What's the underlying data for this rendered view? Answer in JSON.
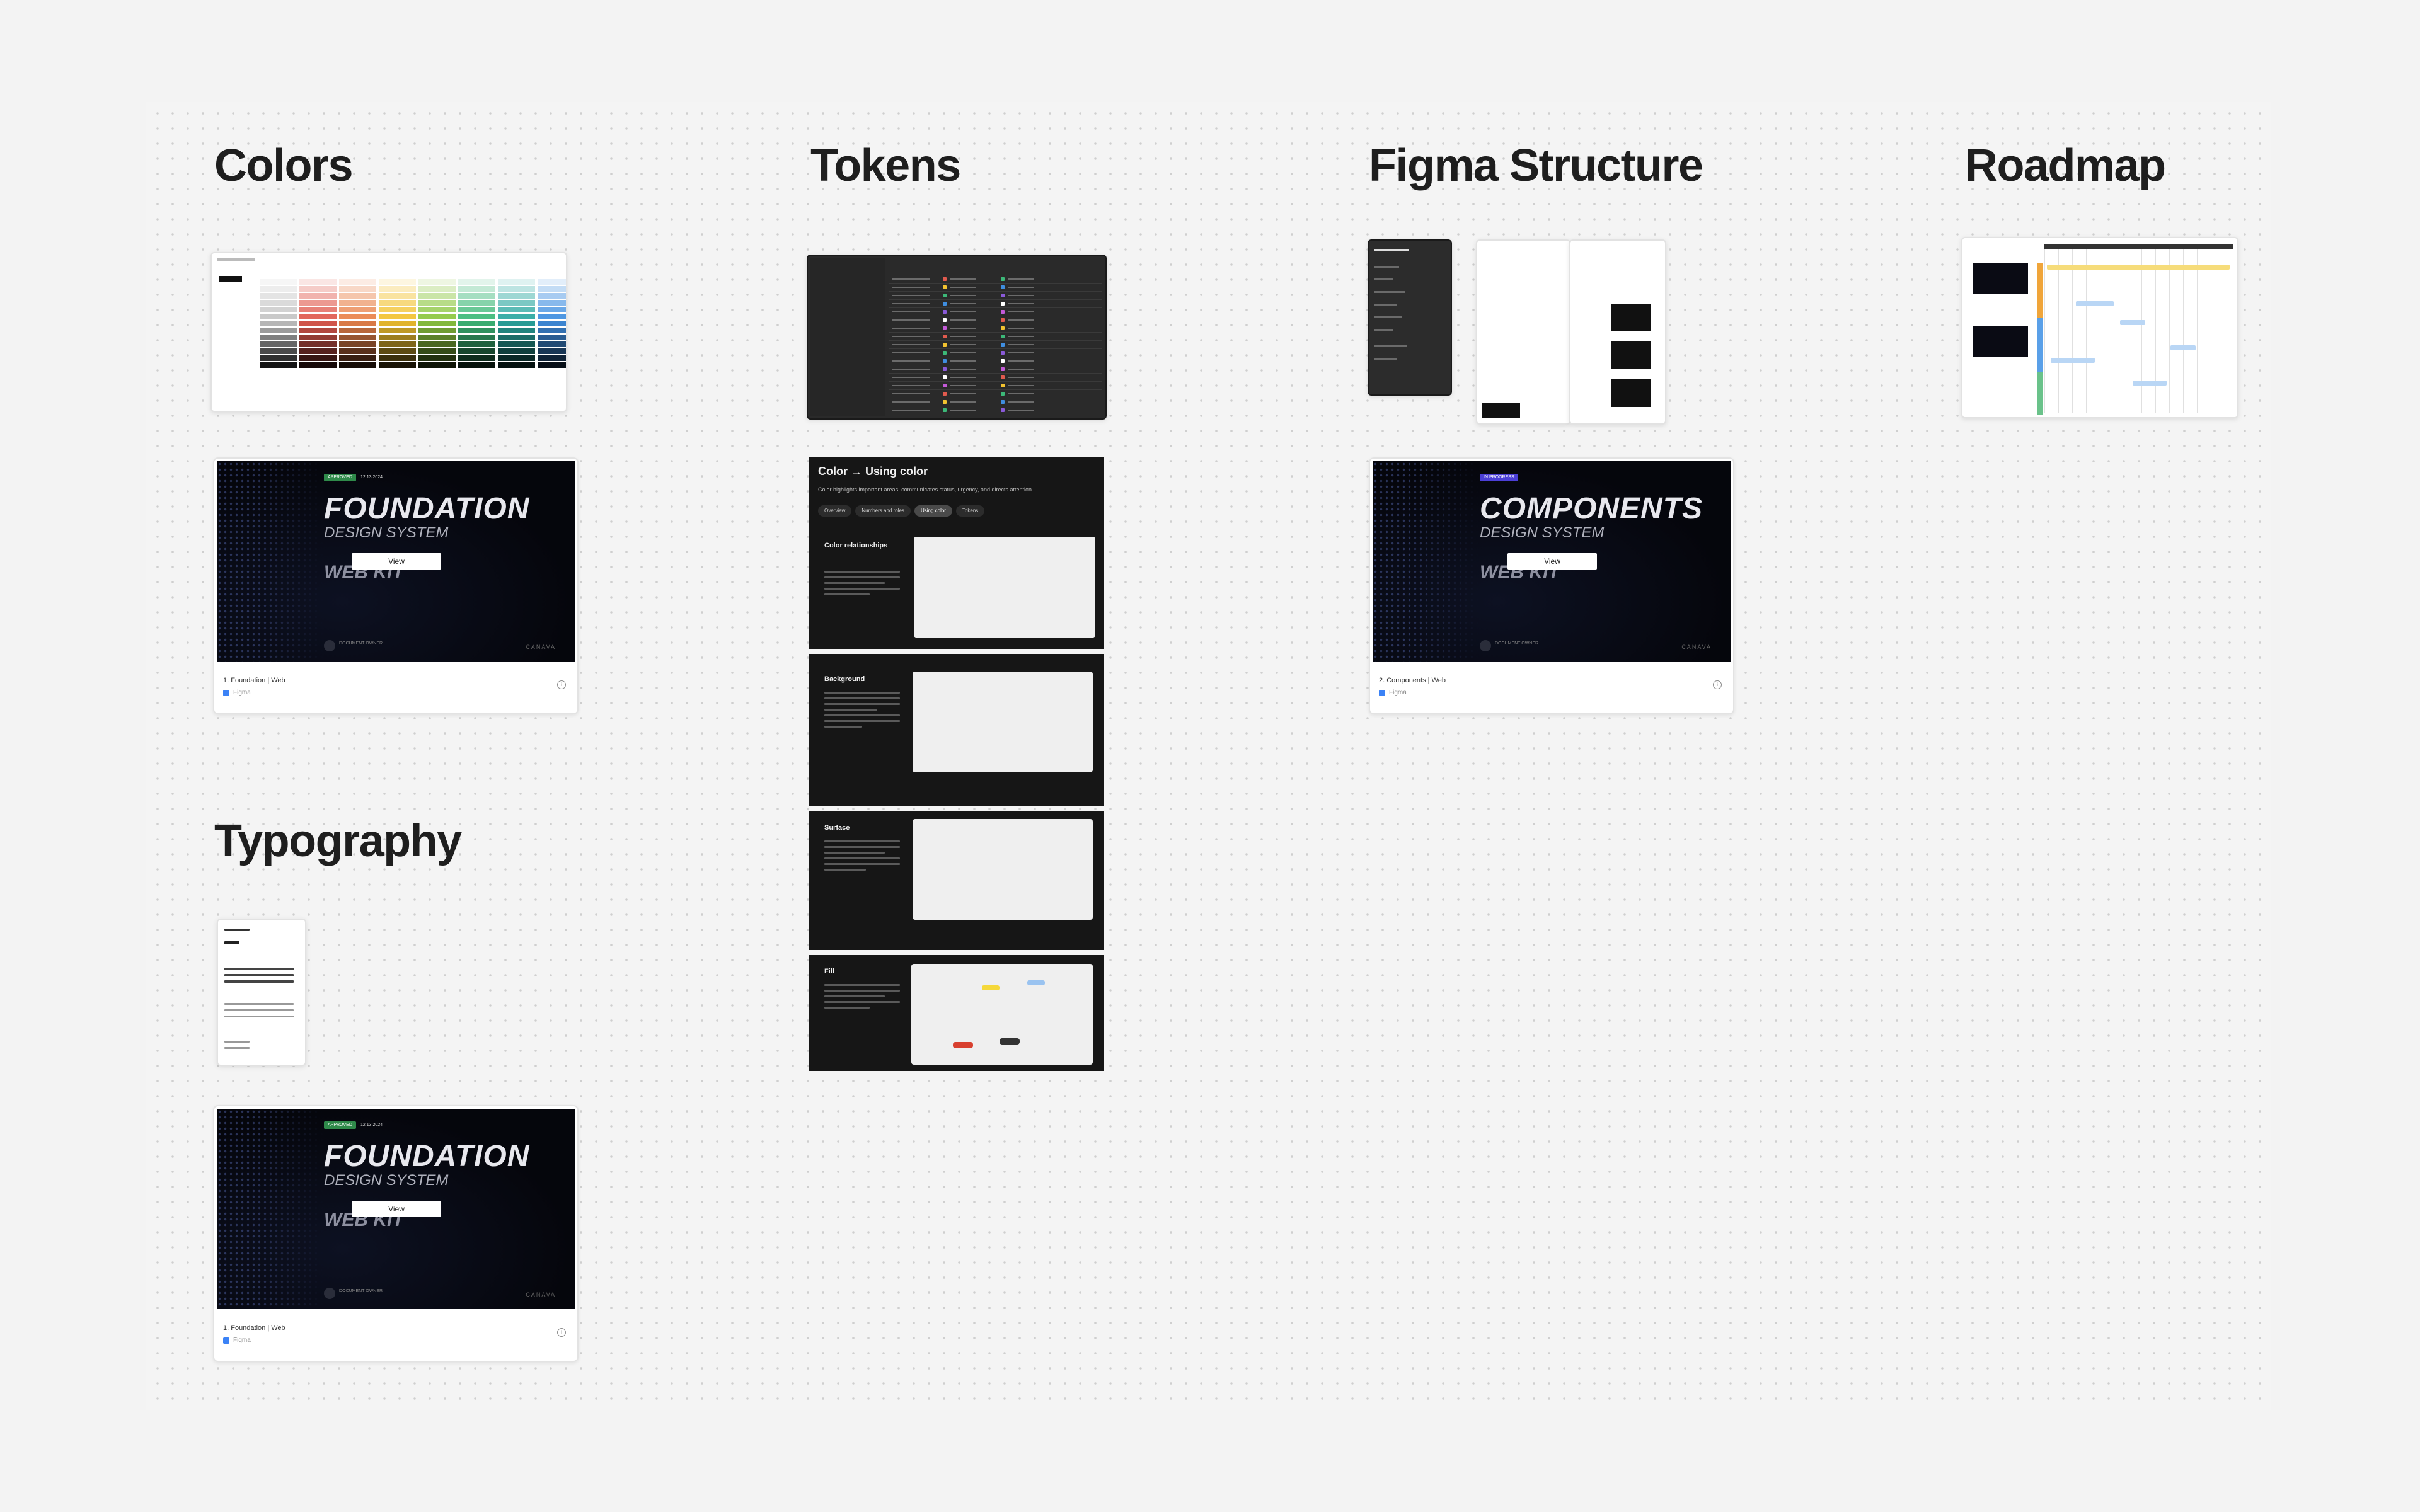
{
  "sections": {
    "colors": "Colors",
    "tokens": "Tokens",
    "figma_structure": "Figma Structure",
    "roadmap": "Roadmap",
    "typography": "Typography"
  },
  "cards": [
    {
      "badge": "APPROVED",
      "badge_color": "#2f8a4a",
      "date": "12.13.2024",
      "title": "FOUNDATION",
      "subtitle": "DESIGN SYSTEM",
      "kit": "WEB KIT",
      "button": "View",
      "author": "DOCUMENT OWNER",
      "brand": "CANAVA",
      "name": "1. Foundation | Web",
      "app": "Figma"
    },
    {
      "badge": "IN PROGRESS",
      "badge_color": "#4b3fd6",
      "date": "",
      "title": "COMPONENTS",
      "subtitle": "DESIGN SYSTEM",
      "kit": "WEB KIT",
      "button": "View",
      "author": "DOCUMENT OWNER",
      "brand": "CANAVA",
      "name": "2. Components | Web",
      "app": "Figma"
    },
    {
      "badge": "APPROVED",
      "badge_color": "#2f8a4a",
      "date": "12.13.2024",
      "title": "FOUNDATION",
      "subtitle": "DESIGN SYSTEM",
      "kit": "WEB KIT",
      "button": "View",
      "author": "DOCUMENT OWNER",
      "brand": "CANAVA",
      "name": "1. Foundation | Web",
      "app": "Figma"
    }
  ],
  "using_color": {
    "title": "Color → Using color",
    "subtitle": "Color highlights important areas, communicates status, urgency, and directs attention.",
    "tabs": [
      "Overview",
      "Numbers and roles",
      "Using color",
      "Tokens"
    ],
    "active_tab": 2,
    "sections": [
      "Color relationships",
      "Background",
      "Surface",
      "Fill"
    ]
  },
  "palette_colors": [
    "#c4c4c4",
    "#e05a4e",
    "#e9824a",
    "#f2c230",
    "#8cc63f",
    "#3cb878",
    "#2aa7a0",
    "#3f8ee0",
    "#5a6fd8",
    "#8a5ad8",
    "#c45ad8",
    "#d85a8a"
  ],
  "icons": {
    "info": "info-icon",
    "figma": "figma-icon"
  }
}
